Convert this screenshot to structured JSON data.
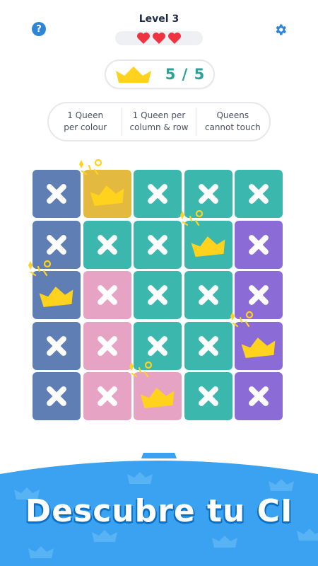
{
  "header": {
    "level_title": "Level 3",
    "lives": 3,
    "help_label": "?"
  },
  "score": {
    "text": "5 / 5",
    "collected": 5,
    "total": 5
  },
  "rules": [
    {
      "line1": "1 Queen",
      "line2": "per colour"
    },
    {
      "line1": "1 Queen per",
      "line2": "column & row"
    },
    {
      "line1": "Queens",
      "line2": "cannot touch"
    }
  ],
  "colors": {
    "slate": "#5f7fb4",
    "gold": "#e4b93f",
    "teal": "#3bb7ad",
    "purple": "#8b6bd6",
    "pink": "#e7a3c3",
    "crown": "#ffd21e",
    "accent_blue": "#2f86d6",
    "heart": "#ef3340",
    "banner": "#3aa2f0"
  },
  "board": {
    "size": 5,
    "regions": [
      [
        "slate",
        "gold",
        "teal",
        "teal",
        "teal"
      ],
      [
        "slate",
        "teal",
        "teal",
        "teal",
        "purple"
      ],
      [
        "slate",
        "pink",
        "teal",
        "teal",
        "purple"
      ],
      [
        "slate",
        "pink",
        "teal",
        "teal",
        "purple"
      ],
      [
        "slate",
        "pink",
        "pink",
        "teal",
        "purple"
      ]
    ],
    "queens": [
      [
        0,
        1
      ],
      [
        1,
        3
      ],
      [
        2,
        0
      ],
      [
        3,
        4
      ],
      [
        4,
        2
      ]
    ]
  },
  "banner": {
    "title": "Descubre tu CI"
  }
}
